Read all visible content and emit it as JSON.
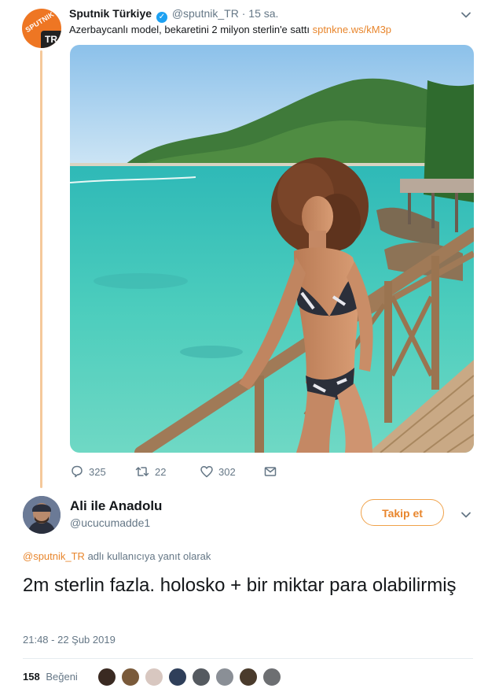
{
  "tweet": {
    "account_name": "Sputnik Türkiye",
    "handle": "@sputnik_TR",
    "separator": "·",
    "time": "15 sa.",
    "text": "Azerbaycanlı model, bekaretini 2 milyon sterlin'e sattı",
    "link": "sptnkne.ws/kM3p",
    "avatar": {
      "word": "SPUTNIK",
      "badge": "TR"
    },
    "verified_icon": "✓",
    "actions": {
      "replies": "325",
      "retweets": "22",
      "likes": "302"
    }
  },
  "reply": {
    "account_name": "Ali ile Anadolu",
    "handle": "@ucucumadde1",
    "follow_label": "Takip et",
    "reply_to_mention": "@sputnik_TR",
    "reply_to_suffix": "adlı kullanıcıya yanıt olarak",
    "text": "2m sterlin fazla. holosko + bir miktar para olabilirmiş",
    "timestamp": "21:48 - 22 Şub 2019",
    "like_count": "158",
    "like_label": "Beğeni",
    "likers_count": 8
  },
  "colors": {
    "accent": "#e8862d",
    "muted": "#657786",
    "verified": "#1da1f2",
    "thread_line": "#f5c99b"
  },
  "icons": [
    "verified-badge-icon",
    "chevron-down-icon",
    "reply-icon",
    "retweet-icon",
    "heart-icon",
    "message-icon"
  ]
}
